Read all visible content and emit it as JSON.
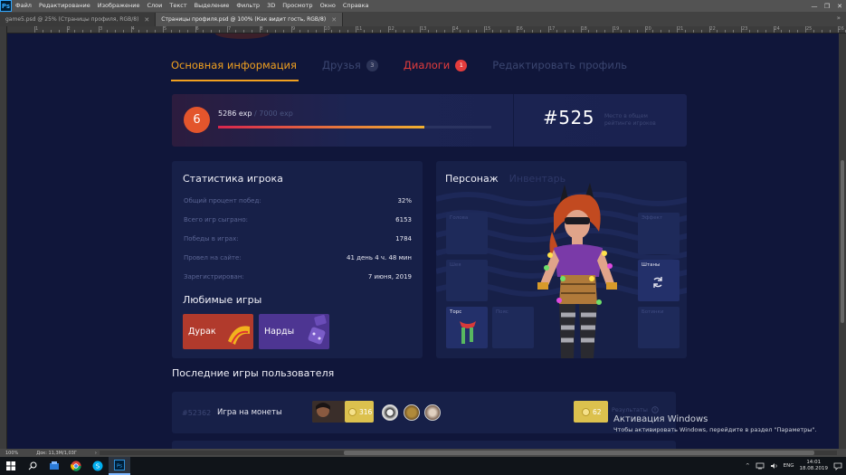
{
  "app": {
    "logo": "Ps",
    "menu": [
      "Файл",
      "Редактирование",
      "Изображение",
      "Слои",
      "Текст",
      "Выделение",
      "Фильтр",
      "3D",
      "Просмотр",
      "Окно",
      "Справка"
    ],
    "window_controls": [
      "—",
      "❐",
      "✕"
    ]
  },
  "doc_tabs": [
    {
      "label": "game5.psd @ 25% (Страницы профиля, RGB/8)",
      "close": "✕"
    },
    {
      "label": "Страницы профиля.psd @ 100% (Как видит гость, RGB/8)",
      "close": "✕"
    }
  ],
  "tab_collapse": "»",
  "ruler_numbers": [
    "1",
    "2",
    "3",
    "4",
    "5",
    "6",
    "7",
    "8",
    "9",
    "10",
    "11",
    "12",
    "13",
    "14",
    "15",
    "16",
    "17",
    "18",
    "19",
    "20",
    "21",
    "22",
    "23",
    "24",
    "25",
    "26"
  ],
  "statusbar": {
    "zoom": "100%",
    "doc": "Док: 11,3М/1,03Г",
    "arrow": "›"
  },
  "design": {
    "nav": {
      "main_info": "Основная информация",
      "friends": "Друзья",
      "friends_count": "3",
      "dialogs": "Диалоги",
      "dialogs_count": "1",
      "edit_profile": "Редактировать профиль"
    },
    "exp": {
      "level": "6",
      "current": "5286 exp",
      "sep": " / ",
      "max": "7000 exp",
      "progress": 0.755,
      "rank": "#525",
      "rank_desc": "Место в общем рейтинге игроков"
    },
    "stats": {
      "title": "Статистика игрока",
      "rows": [
        {
          "label": "Общий процент побед:",
          "value": "32%"
        },
        {
          "label": "Всего игр сыграно:",
          "value": "6153"
        },
        {
          "label": "Победы в играх:",
          "value": "1784"
        },
        {
          "label": "Провел на сайте:",
          "value": "41 день 4 ч. 48 мин"
        },
        {
          "label": "Зарегистрирован:",
          "value": "7 июня, 2019"
        }
      ],
      "fav_title": "Любимые игры",
      "fav_games": [
        "Дурак",
        "Нарды"
      ]
    },
    "character": {
      "tab_active": "Персонаж",
      "tab_inactive": "Инвентарь",
      "slots": {
        "head": "Голова",
        "neck": "Шея",
        "torso": "Торс",
        "belt": "Пояс",
        "effect": "Эффект",
        "pants": "Штаны",
        "boots": "Ботинки"
      }
    },
    "recent": {
      "title": "Последние игры пользователя",
      "rows": [
        {
          "id": "#52362",
          "name": "Игра на монеты",
          "coins": "316",
          "prize": "62",
          "results": "Результаты"
        }
      ]
    }
  },
  "overlay": {
    "activation_title": "Активация Windows",
    "activation_text": "Чтобы активировать Windows, перейдите в раздел \"Параметры\"."
  },
  "taskbar": {
    "lang": "ENG",
    "time": "14:01",
    "date": "18.08.2019",
    "tray_arrow": "^"
  },
  "colors": {
    "accent_orange": "#f0a020",
    "accent_red": "#e43c3c",
    "bg_design": "#10163a",
    "card": "#172048",
    "coin_gold": "#dcc14e"
  }
}
